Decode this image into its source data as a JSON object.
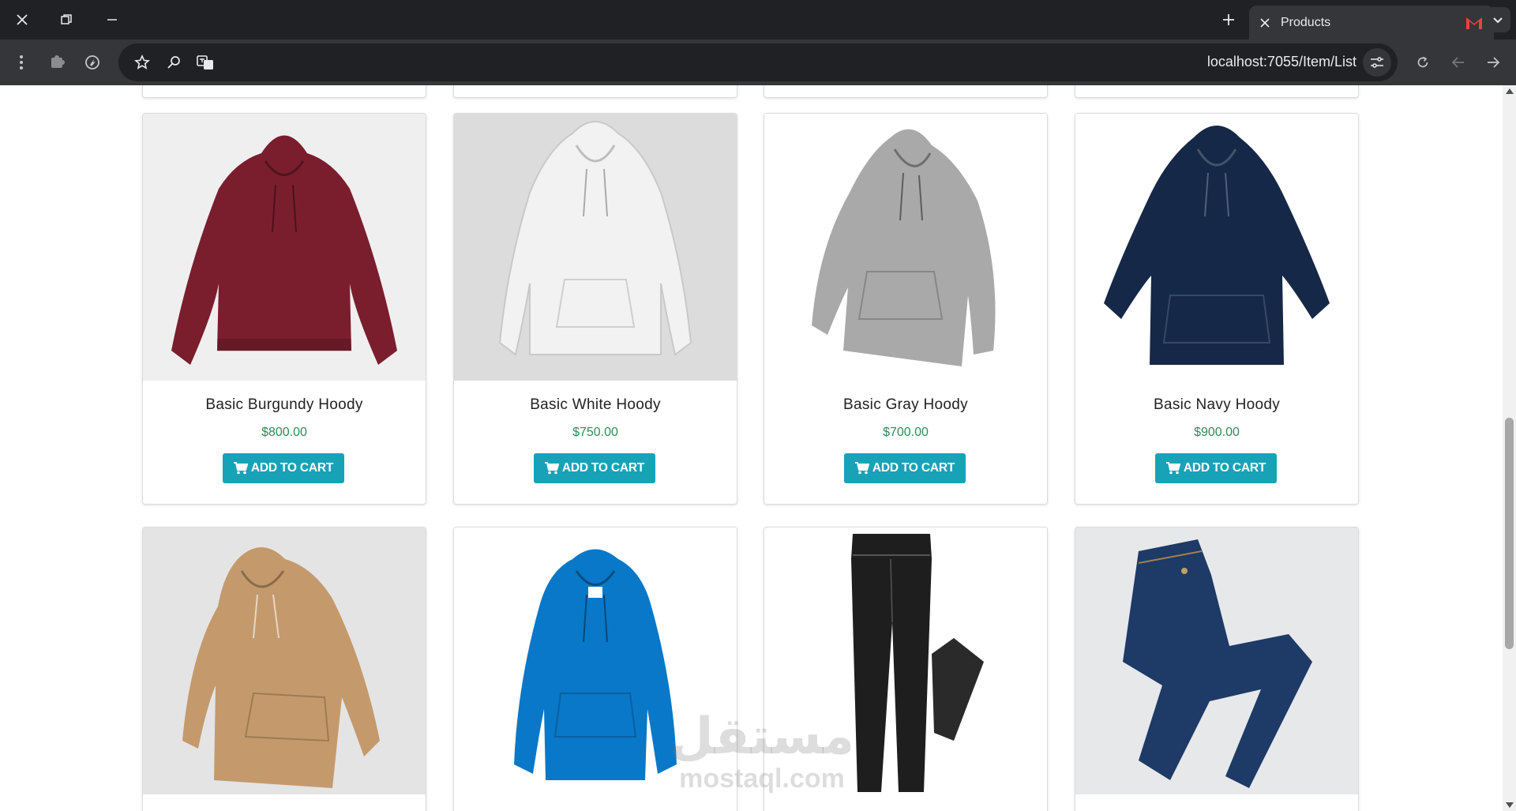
{
  "browser": {
    "tab_title": "Products",
    "url": "localhost:7055/Item/List",
    "accent_colors": {
      "chrome_dark": "#202124",
      "chrome_mid": "#35363a",
      "favicon": "#ea4335"
    }
  },
  "products": [
    {
      "name": "Basic Burgundy Hoody",
      "price": "$800.00",
      "cart_label": "ADD TO CART",
      "color": "#7a1e2e"
    },
    {
      "name": "Basic White Hoody",
      "price": "$750.00",
      "cart_label": "ADD TO CART",
      "color": "#f2f2f2"
    },
    {
      "name": "Basic Gray Hoody",
      "price": "$700.00",
      "cart_label": "ADD TO CART",
      "color": "#a9a9a9"
    },
    {
      "name": "Basic Navy Hoody",
      "price": "$900.00",
      "cart_label": "ADD TO CART",
      "color": "#162848"
    },
    {
      "color": "#c49a6c"
    },
    {
      "color": "#0a78c8"
    },
    {
      "color": "#1e1e1e"
    },
    {
      "color": "#1e3a66"
    }
  ],
  "theme": {
    "button_color": "#17a2b8",
    "price_color": "#2e8b57"
  },
  "watermark": {
    "arabic": "مستقل",
    "latin": "mostaql.com"
  }
}
